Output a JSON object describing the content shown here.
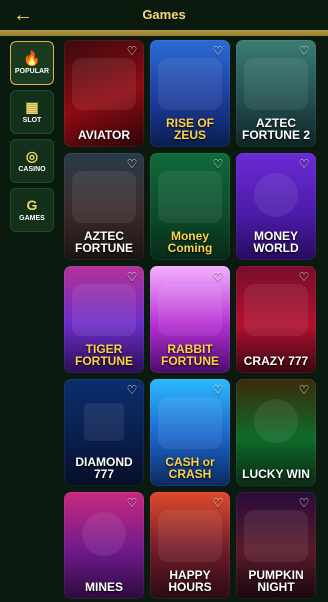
{
  "header": {
    "title": "Games",
    "back_icon": "arrow-left-icon"
  },
  "sidebar": {
    "items": [
      {
        "label": "POPULAR",
        "icon": "flame-icon",
        "active": true
      },
      {
        "label": "SLOT",
        "icon": "slot-reels-icon",
        "active": false
      },
      {
        "label": "CASINO",
        "icon": "casino-chip-icon",
        "active": false
      },
      {
        "label": "GAMES",
        "icon": "g-letter-icon",
        "active": false
      }
    ]
  },
  "games": [
    {
      "name": "AVIATOR",
      "fav_icon": "heart-outline-icon"
    },
    {
      "name": "RISE OF ZEUS",
      "fav_icon": "heart-outline-icon"
    },
    {
      "name": "AZTEC FORTUNE 2",
      "fav_icon": "heart-outline-icon"
    },
    {
      "name": "AZTEC FORTUNE",
      "fav_icon": "heart-outline-icon"
    },
    {
      "name": "Money Coming",
      "fav_icon": "heart-outline-icon"
    },
    {
      "name": "MONEY WORLD",
      "fav_icon": "heart-outline-icon"
    },
    {
      "name": "TIGER FORTUNE",
      "fav_icon": "heart-outline-icon"
    },
    {
      "name": "RABBIT FORTUNE",
      "fav_icon": "heart-outline-icon"
    },
    {
      "name": "CRAZY 777",
      "fav_icon": "heart-outline-icon"
    },
    {
      "name": "DIAMOND 777",
      "fav_icon": "heart-outline-icon"
    },
    {
      "name": "CASH or CRASH",
      "fav_icon": "heart-outline-icon"
    },
    {
      "name": "LUCKY WIN",
      "fav_icon": "heart-outline-icon"
    },
    {
      "name": "MINES",
      "fav_icon": "heart-outline-icon"
    },
    {
      "name": "HAPPY HOURS",
      "fav_icon": "heart-outline-icon"
    },
    {
      "name": "PUMPKIN NIGHT",
      "fav_icon": "heart-outline-icon"
    }
  ],
  "colors": {
    "background": "#0b1a0f",
    "header_text": "#f3d77a",
    "gold_bar": "#c9a94a",
    "sidebar_item": "#12301a",
    "sidebar_active_border": "#d7b64f"
  }
}
